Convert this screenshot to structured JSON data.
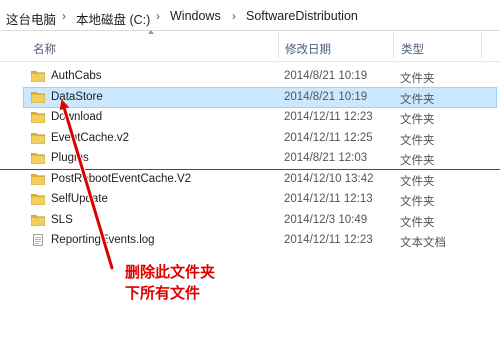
{
  "breadcrumb": [
    "这台电脑",
    "本地磁盘 (C:)",
    "Windows",
    "SoftwareDistribution"
  ],
  "columns": {
    "name": "名称",
    "date": "修改日期",
    "type": "类型"
  },
  "files": [
    {
      "name": "AuthCabs",
      "date": "2014/8/21 10:19",
      "type": "文件夹",
      "icon": "folder-icon"
    },
    {
      "name": "DataStore",
      "date": "2014/8/21 10:19",
      "type": "文件夹",
      "icon": "folder-icon",
      "selected": true
    },
    {
      "name": "Download",
      "date": "2014/12/11 12:23",
      "type": "文件夹",
      "icon": "folder-icon"
    },
    {
      "name": "EventCache.v2",
      "date": "2014/12/11 12:25",
      "type": "文件夹",
      "icon": "folder-icon"
    },
    {
      "name": "Plugins",
      "date": "2014/8/21 12:03",
      "type": "文件夹",
      "icon": "folder-icon"
    },
    {
      "name": "PostRebootEventCache.V2",
      "date": "2014/12/10 13:42",
      "type": "文件夹",
      "icon": "folder-icon"
    },
    {
      "name": "SelfUpdate",
      "date": "2014/12/11 12:13",
      "type": "文件夹",
      "icon": "folder-icon"
    },
    {
      "name": "SLS",
      "date": "2014/12/3 10:49",
      "type": "文件夹",
      "icon": "folder-icon"
    },
    {
      "name": "ReportingEvents.log",
      "date": "2014/12/11 12:23",
      "type": "文本文档",
      "icon": "text-file-icon"
    }
  ],
  "annotation": {
    "line1": "删除此文件夹",
    "line2": "下所有文件",
    "color": "#e10000"
  },
  "colors": {
    "selection": "#cce8ff",
    "folder": "#e8c04a"
  }
}
